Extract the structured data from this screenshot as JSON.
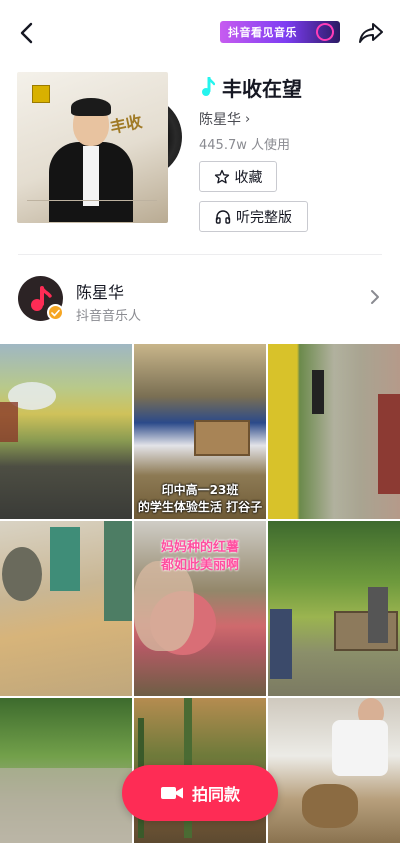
{
  "topbar": {
    "banner_text": "抖音看见音乐",
    "back_icon": "back-arrow-icon",
    "share_icon": "share-arrow-icon"
  },
  "song": {
    "title": "丰收在望",
    "artist": "陈星华",
    "usage": "445.7w 人使用",
    "collect_label": "收藏",
    "full_version_label": "听完整版",
    "cover_calligraphy": "丰收在望"
  },
  "artist_row": {
    "name": "陈星华",
    "subtitle": "抖音音乐人"
  },
  "videos": [
    {
      "caption": ""
    },
    {
      "caption_line1": "印中高一23班",
      "caption_line2": "的学生体验生活 打谷子"
    },
    {
      "caption": ""
    },
    {
      "caption": ""
    },
    {
      "caption_line1": "妈妈种的红薯",
      "caption_line2": "都如此美丽啊"
    },
    {
      "caption": ""
    },
    {
      "caption": ""
    },
    {
      "caption": ""
    },
    {
      "caption": ""
    }
  ],
  "action": {
    "shoot_label": "拍同款"
  },
  "colors": {
    "accent": "#fe2c55",
    "note_icon": "#25f4ee",
    "badge": "#f6a623"
  }
}
